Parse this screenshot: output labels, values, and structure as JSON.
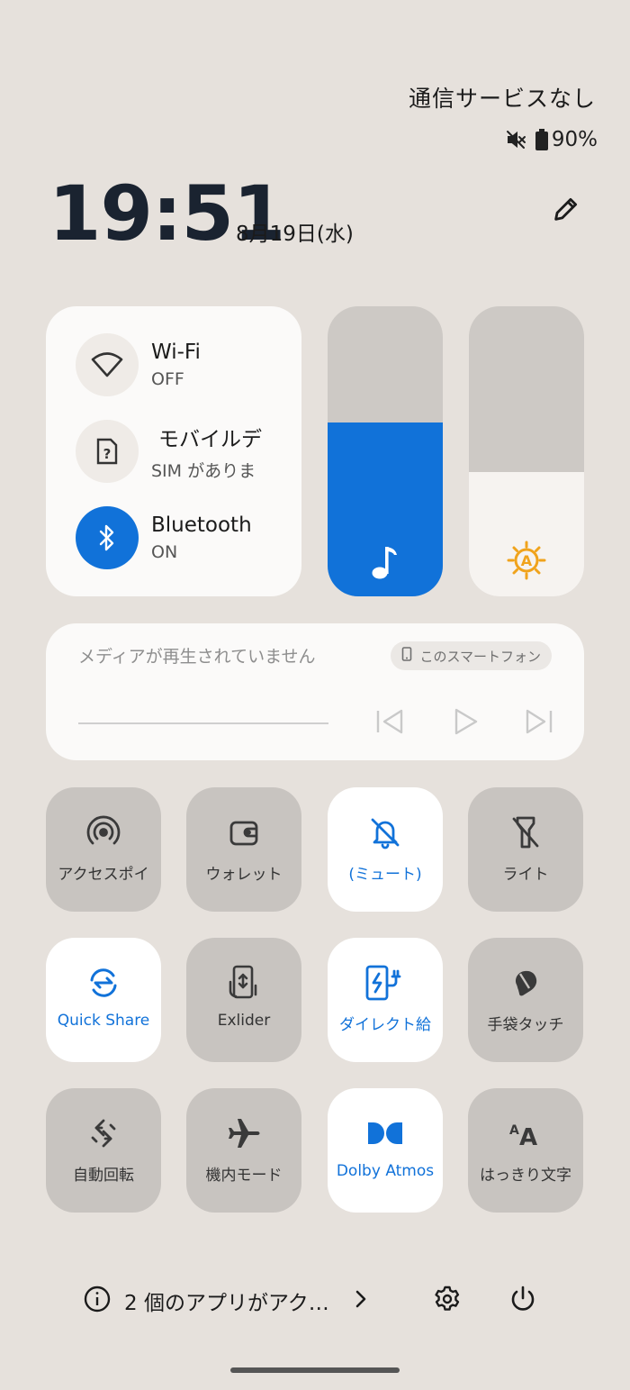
{
  "header": {
    "carrier": "通信サービスなし",
    "battery": "90%",
    "time": "19:51",
    "date": "8月19日(水)"
  },
  "connectivity": [
    {
      "title": "Wi-Fi",
      "subtitle": "OFF",
      "icon": "wifi-icon",
      "state": "off"
    },
    {
      "title": "モバイルデ",
      "subtitle": "SIM がありま",
      "icon": "sim-icon",
      "state": "off"
    },
    {
      "title": "Bluetooth",
      "subtitle": "ON",
      "icon": "bluetooth-icon",
      "state": "on"
    }
  ],
  "sliders": {
    "volume": {
      "level": 0.6,
      "icon": "music-note-icon",
      "color": "#1172d9"
    },
    "brightness": {
      "level": 0.43,
      "icon": "auto-brightness-icon",
      "color": "#f6f3f0"
    }
  },
  "media": {
    "status": "メディアが再生されていません",
    "output": "このスマートフォン"
  },
  "tiles": [
    {
      "label": "アクセスポイ",
      "icon": "hotspot-icon",
      "active": false
    },
    {
      "label": "ウォレット",
      "icon": "wallet-icon",
      "active": false
    },
    {
      "label": "(ミュート)",
      "icon": "bell-off-icon",
      "active": true
    },
    {
      "label": "ライト",
      "icon": "flashlight-off-icon",
      "active": false
    },
    {
      "label": "Quick Share",
      "icon": "quick-share-icon",
      "active": true
    },
    {
      "label": "Exlider",
      "icon": "exlider-icon",
      "active": false
    },
    {
      "label": "ダイレクト給",
      "icon": "direct-charge-icon",
      "active": true
    },
    {
      "label": "手袋タッチ",
      "icon": "glove-touch-icon",
      "active": false
    },
    {
      "label": "自動回転",
      "icon": "auto-rotate-icon",
      "active": false
    },
    {
      "label": "機内モード",
      "icon": "airplane-icon",
      "active": false
    },
    {
      "label": "Dolby Atmos",
      "icon": "dolby-icon",
      "active": true
    },
    {
      "label": "はっきり文字",
      "icon": "text-contrast-icon",
      "active": false
    }
  ],
  "footer": {
    "active_apps": "2 個のアプリがアク…"
  },
  "colors": {
    "background": "#e6e1dc",
    "accent": "#1172d9",
    "tile_inactive": "#c8c4c0",
    "tile_active": "#ffffff"
  }
}
